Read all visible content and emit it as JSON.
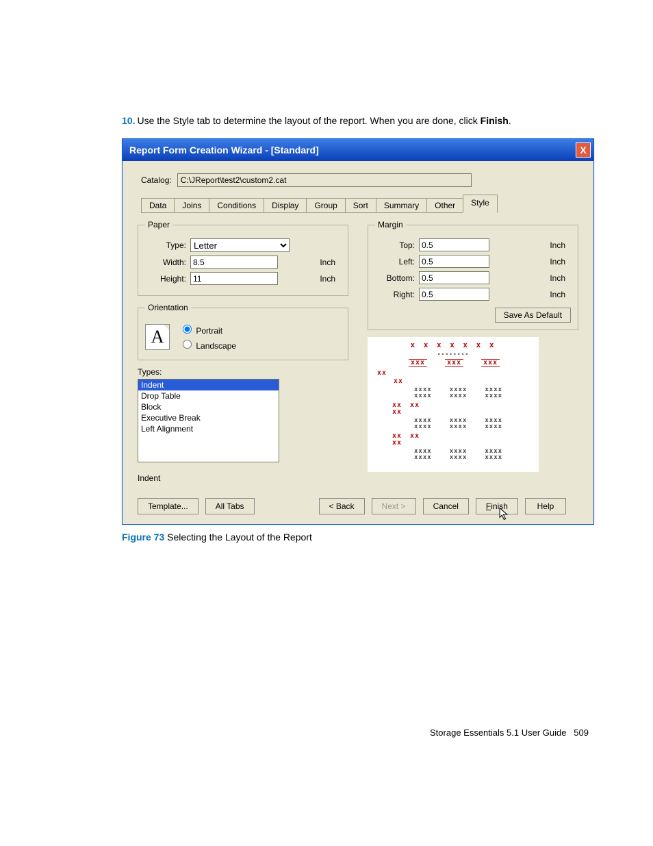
{
  "step": {
    "number": "10.",
    "text_a": "Use the Style tab to determine the layout of the report. When you are done, click ",
    "bold": "Finish",
    "text_b": "."
  },
  "window": {
    "title": "Report Form Creation Wizard - [Standard]",
    "close": "X"
  },
  "catalog": {
    "label": "Catalog:",
    "value": "C:\\JReport\\test2\\custom2.cat"
  },
  "tabs": [
    "Data",
    "Joins",
    "Conditions",
    "Display",
    "Group",
    "Sort",
    "Summary",
    "Other",
    "Style"
  ],
  "active_tab": "Style",
  "paper": {
    "legend": "Paper",
    "type_label": "Type:",
    "type_value": "Letter",
    "width_label": "Width:",
    "width_value": "8.5",
    "height_label": "Height:",
    "height_value": "11",
    "unit": "Inch"
  },
  "orientation": {
    "legend": "Orientation",
    "icon_text": "A",
    "portrait": "Portrait",
    "landscape": "Landscape",
    "selected": "portrait"
  },
  "margin": {
    "legend": "Margin",
    "top_label": "Top:",
    "top_value": "0.5",
    "left_label": "Left:",
    "left_value": "0.5",
    "bottom_label": "Bottom:",
    "bottom_value": "0.5",
    "right_label": "Right:",
    "right_value": "0.5",
    "unit": "Inch",
    "save_default": "Save As Default"
  },
  "types": {
    "label": "Types:",
    "items": [
      "Indent",
      "Drop Table",
      "Block",
      "Executive Break",
      "Left Alignment"
    ],
    "selected": "Indent",
    "selected_display": "Indent"
  },
  "buttons": {
    "template": "Template...",
    "all_tabs": "All Tabs",
    "back": "< Back",
    "next": "Next >",
    "cancel": "Cancel",
    "finish": "Finish",
    "help": "Help"
  },
  "caption": {
    "fig": "Figure 73",
    "text": "  Selecting the Layout of the Report"
  },
  "footer": {
    "guide": "Storage Essentials 5.1 User Guide",
    "page": "509"
  }
}
